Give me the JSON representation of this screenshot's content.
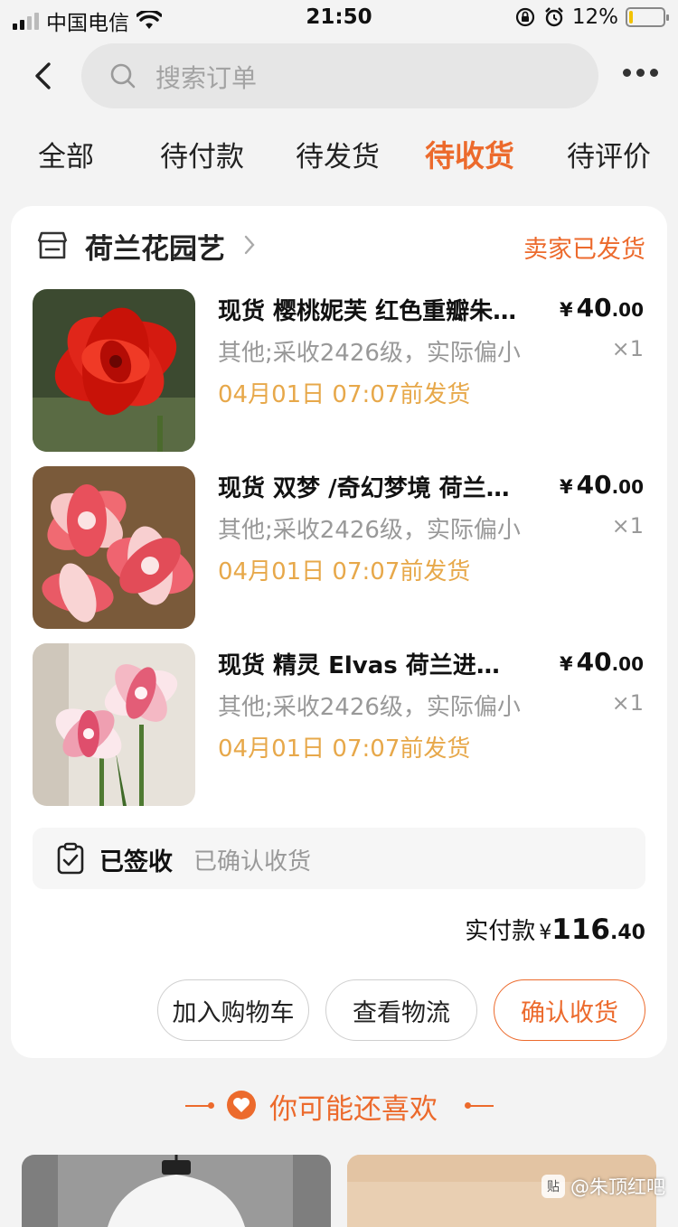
{
  "status_bar": {
    "carrier": "中国电信",
    "time": "21:50",
    "battery_text": "12%",
    "battery_level": 0.12
  },
  "search": {
    "placeholder": "搜索订单"
  },
  "tabs": [
    {
      "label": "全部",
      "active": false
    },
    {
      "label": "待付款",
      "active": false
    },
    {
      "label": "待发货",
      "active": false
    },
    {
      "label": "待收货",
      "active": true
    },
    {
      "label": "待评价",
      "active": false
    }
  ],
  "order": {
    "shop_name": "荷兰花园艺",
    "ship_status": "卖家已发货",
    "items": [
      {
        "title": "现货 樱桃妮芙 红色重瓣朱顶红",
        "sku": "其他;采收2426级，实际偏小",
        "ship_time": "04月01日 07:07前发货",
        "price_yen": "¥",
        "price_int": "40",
        "price_dec": ".00",
        "qty": "×1"
      },
      {
        "title": "现货 双梦 /奇幻梦境 荷兰进口",
        "sku": "其他;采收2426级，实际偏小",
        "ship_time": "04月01日 07:07前发货",
        "price_yen": "¥",
        "price_int": "40",
        "price_dec": ".00",
        "qty": "×1"
      },
      {
        "title": "现货 精灵 Elvas  荷兰进口朱顶红",
        "sku": "其他;采收2426级，实际偏小",
        "ship_time": "04月01日 07:07前发货",
        "price_yen": "¥",
        "price_int": "40",
        "price_dec": ".00",
        "qty": "×1"
      }
    ],
    "sign": {
      "title": "已签收",
      "subtitle": "已确认收货"
    },
    "paid": {
      "label": "实付款",
      "yen": "¥",
      "int": "116",
      "dec": ".40"
    },
    "buttons": {
      "add_cart": "加入购物车",
      "logistics": "查看物流",
      "confirm": "确认收货"
    }
  },
  "recommend": {
    "title": "你可能还喜欢"
  },
  "watermark": {
    "text": "@朱顶红吧"
  },
  "colors": {
    "accent": "#ec6a2c",
    "ship_time": "#e7a84a"
  }
}
